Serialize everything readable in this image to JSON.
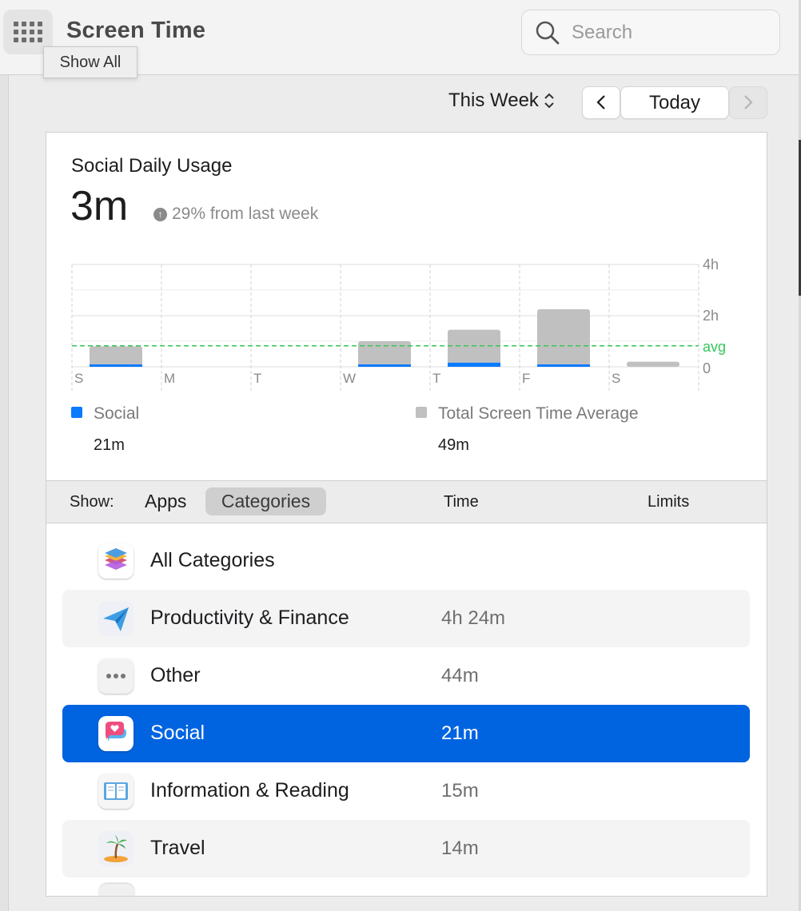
{
  "window": {
    "title": "Screen Time",
    "tooltip": "Show All"
  },
  "search": {
    "placeholder": "Search"
  },
  "period": {
    "selector": "This Week",
    "today_label": "Today"
  },
  "usage": {
    "title": "Social Daily Usage",
    "value": "3m",
    "change": "29% from last week"
  },
  "chart_data": {
    "type": "bar",
    "categories": [
      "S",
      "M",
      "T",
      "W",
      "T",
      "F",
      "S"
    ],
    "series": [
      {
        "name": "Social",
        "color": "#0a7aff",
        "values": [
          0.02,
          0,
          0,
          0.08,
          0.16,
          0.06,
          0
        ]
      },
      {
        "name": "Total Screen Time Average",
        "color": "#c0c0c0",
        "values": [
          0.8,
          0,
          0,
          1.0,
          1.45,
          2.25,
          0.2
        ]
      }
    ],
    "y_ticks": [
      "0",
      "2h",
      "4h"
    ],
    "ylim": [
      0,
      4
    ],
    "avg": {
      "label": "avg",
      "value": 0.82,
      "color": "#34c759"
    }
  },
  "legend": [
    {
      "label": "Social",
      "value": "21m",
      "color": "#0a7aff"
    },
    {
      "label": "Total Screen Time Average",
      "value": "49m",
      "color": "#c0c0c0"
    }
  ],
  "showbar": {
    "label": "Show:",
    "apps": "Apps",
    "categories": "Categories",
    "time": "Time",
    "limits": "Limits"
  },
  "categories": [
    {
      "name": "All Categories",
      "time": "",
      "icon": "stack-icon"
    },
    {
      "name": "Productivity & Finance",
      "time": "4h 24m",
      "icon": "paper-plane-icon"
    },
    {
      "name": "Other",
      "time": "44m",
      "icon": "ellipsis-icon"
    },
    {
      "name": "Social",
      "time": "21m",
      "icon": "chat-heart-icon"
    },
    {
      "name": "Information & Reading",
      "time": "15m",
      "icon": "book-icon"
    },
    {
      "name": "Travel",
      "time": "14m",
      "icon": "palm-tree-icon"
    }
  ]
}
